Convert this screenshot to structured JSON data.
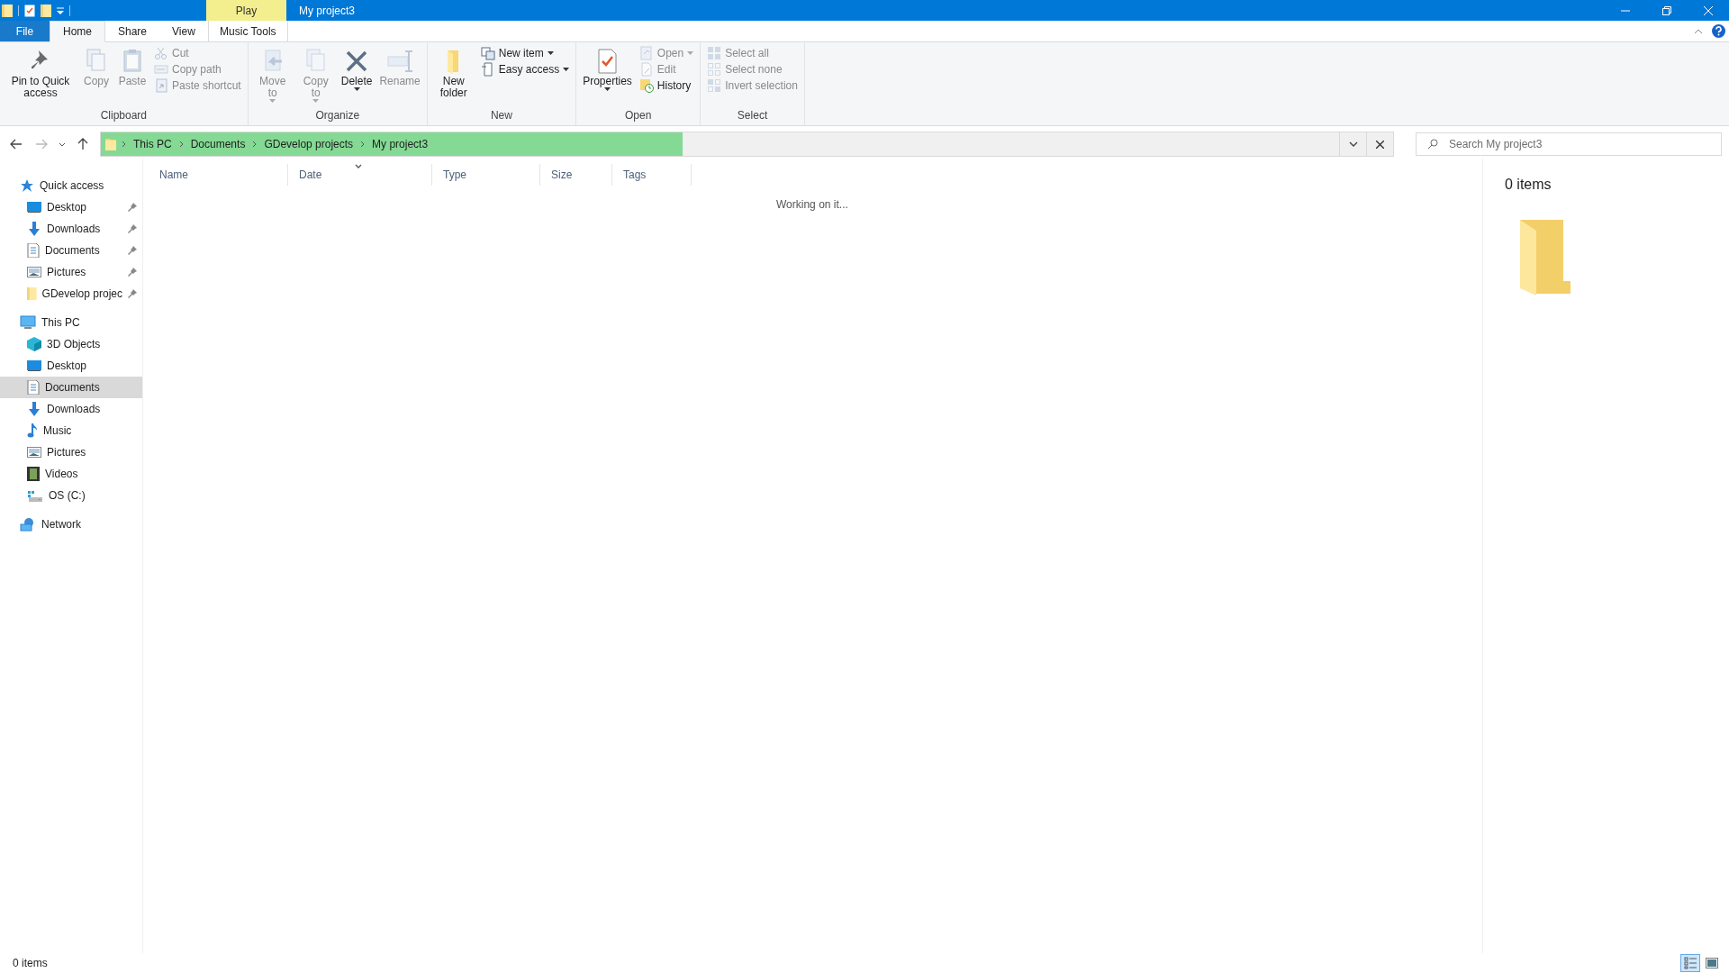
{
  "window": {
    "title": "My project3",
    "context_tab": "Play"
  },
  "ribbon_tabs": [
    {
      "label": "File",
      "kind": "file",
      "selected": false
    },
    {
      "label": "Home",
      "kind": "tab",
      "selected": true
    },
    {
      "label": "Share",
      "kind": "tab",
      "selected": false
    },
    {
      "label": "View",
      "kind": "tab",
      "selected": false
    },
    {
      "label": "Music Tools",
      "kind": "context",
      "selected": false
    }
  ],
  "ribbon_groups": [
    {
      "label": "Clipboard",
      "commands": [
        {
          "label": "Pin to Quick access",
          "kind": "large",
          "disabled": false,
          "dropdown": false
        },
        {
          "label": "Copy",
          "kind": "large",
          "disabled": true,
          "dropdown": false
        },
        {
          "label": "Paste",
          "kind": "large",
          "disabled": true,
          "dropdown": false
        },
        {
          "label": "Cut",
          "kind": "small",
          "disabled": true,
          "dropdown": false
        },
        {
          "label": "Copy path",
          "kind": "small",
          "disabled": true,
          "dropdown": false
        },
        {
          "label": "Paste shortcut",
          "kind": "small",
          "disabled": true,
          "dropdown": false
        }
      ]
    },
    {
      "label": "Organize",
      "commands": [
        {
          "label": "Move to",
          "kind": "large",
          "disabled": true,
          "dropdown": true
        },
        {
          "label": "Copy to",
          "kind": "large",
          "disabled": true,
          "dropdown": true
        },
        {
          "label": "Delete",
          "kind": "large",
          "disabled": false,
          "dropdown": true
        },
        {
          "label": "Rename",
          "kind": "large",
          "disabled": true,
          "dropdown": false
        }
      ]
    },
    {
      "label": "New",
      "commands": [
        {
          "label": "New folder",
          "kind": "large",
          "disabled": false,
          "dropdown": false
        },
        {
          "label": "New item",
          "kind": "small",
          "disabled": false,
          "dropdown": true
        },
        {
          "label": "Easy access",
          "kind": "small",
          "disabled": false,
          "dropdown": true
        }
      ]
    },
    {
      "label": "Open",
      "commands": [
        {
          "label": "Properties",
          "kind": "large",
          "disabled": false,
          "dropdown": true
        },
        {
          "label": "Open",
          "kind": "small",
          "disabled": true,
          "dropdown": true
        },
        {
          "label": "Edit",
          "kind": "small",
          "disabled": true,
          "dropdown": false
        },
        {
          "label": "History",
          "kind": "small",
          "disabled": false,
          "dropdown": false
        }
      ]
    },
    {
      "label": "Select",
      "commands": [
        {
          "label": "Select all",
          "kind": "small",
          "disabled": true,
          "dropdown": false
        },
        {
          "label": "Select none",
          "kind": "small",
          "disabled": true,
          "dropdown": false
        },
        {
          "label": "Invert selection",
          "kind": "small",
          "disabled": true,
          "dropdown": false
        }
      ]
    }
  ],
  "address_bar": {
    "path": [
      "This PC",
      "Documents",
      "GDevelop projects",
      "My project3"
    ],
    "level": 0.45
  },
  "search": {
    "placeholder": "Search My project3"
  },
  "navigation": [
    {
      "label": "Quick access",
      "selected": false,
      "children": [
        {
          "label": "Desktop",
          "pinned": true,
          "selected": false
        },
        {
          "label": "Downloads",
          "pinned": true,
          "selected": false
        },
        {
          "label": "Documents",
          "pinned": true,
          "selected": false
        },
        {
          "label": "Pictures",
          "pinned": true,
          "selected": false
        },
        {
          "label": "GDevelop projec",
          "pinned": true,
          "selected": false
        }
      ]
    },
    {
      "label": "This PC",
      "selected": false,
      "children": [
        {
          "label": "3D Objects",
          "pinned": false,
          "selected": false
        },
        {
          "label": "Desktop",
          "pinned": false,
          "selected": false
        },
        {
          "label": "Documents",
          "pinned": false,
          "selected": true
        },
        {
          "label": "Downloads",
          "pinned": false,
          "selected": false
        },
        {
          "label": "Music",
          "pinned": false,
          "selected": false
        },
        {
          "label": "Pictures",
          "pinned": false,
          "selected": false
        },
        {
          "label": "Videos",
          "pinned": false,
          "selected": false
        },
        {
          "label": "OS (C:)",
          "pinned": false,
          "selected": false
        }
      ]
    },
    {
      "label": "Network",
      "selected": false
    }
  ],
  "columns": [
    {
      "label": "Name",
      "sorted": false
    },
    {
      "label": "Date",
      "sorted": true
    },
    {
      "label": "Type",
      "sorted": false
    },
    {
      "label": "Size",
      "sorted": false
    },
    {
      "label": "Tags",
      "sorted": false
    }
  ],
  "message": "Working on it...",
  "details_pane": {
    "count": "0 items"
  },
  "status_bar": {
    "count": "0 items",
    "views": [
      {
        "selected": true
      },
      {
        "selected": false
      }
    ]
  }
}
